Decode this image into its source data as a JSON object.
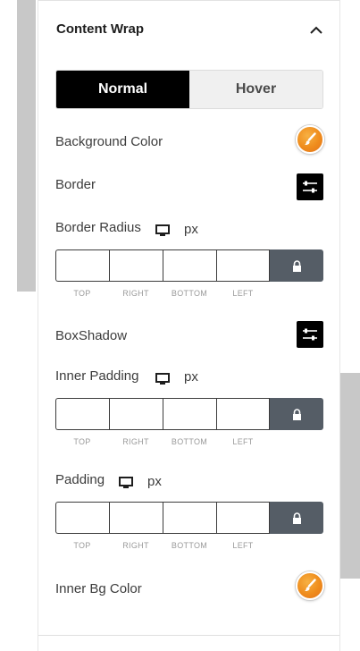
{
  "panel": {
    "section_title": "Content Wrap",
    "tabs": [
      {
        "label": "Normal",
        "active": true
      },
      {
        "label": "Hover",
        "active": false
      }
    ]
  },
  "fields": {
    "background_color": {
      "label": "Background Color"
    },
    "border": {
      "label": "Border"
    },
    "border_radius": {
      "label": "Border Radius",
      "unit": "px",
      "values": [
        "",
        "",
        "",
        ""
      ]
    },
    "box_shadow": {
      "label": "BoxShadow"
    },
    "inner_padding": {
      "label": "Inner Padding",
      "unit": "px",
      "values": [
        "",
        "",
        "",
        ""
      ]
    },
    "padding": {
      "label": "Padding",
      "unit": "px",
      "values": [
        "",
        "",
        "",
        ""
      ]
    },
    "inner_bg_color": {
      "label": "Inner Bg Color"
    }
  },
  "dimension_labels": [
    "TOP",
    "RIGHT",
    "BOTTOM",
    "LEFT"
  ],
  "icons": {
    "collapse": "chevron-up-icon",
    "color_picker": "paintbrush-icon",
    "settings": "sliders-icon",
    "device": "desktop-icon",
    "lock": "lock-icon"
  },
  "colors": {
    "accent_orange": "#ef8c1c",
    "tab_active_bg": "#000000",
    "tab_inactive_bg": "#f0f0f0",
    "lock_bg": "#555d66"
  }
}
